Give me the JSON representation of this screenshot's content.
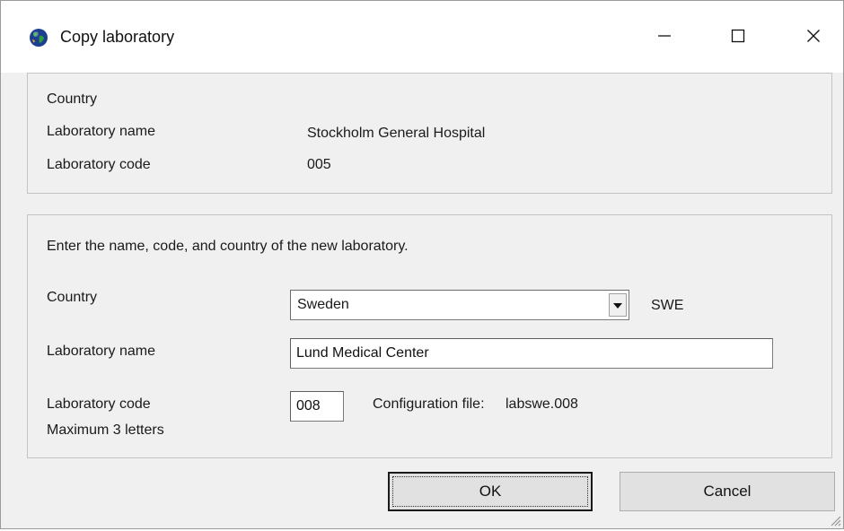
{
  "window": {
    "title": "Copy laboratory",
    "icon": "globe-icon",
    "controls": [
      "minimize-icon",
      "maximize-icon",
      "close-icon"
    ]
  },
  "current_lab": {
    "country_label": "Country",
    "name_label": "Laboratory name",
    "name_value": "Stockholm General Hospital",
    "code_label": "Laboratory code",
    "code_value": "005"
  },
  "new_lab": {
    "instruction": "Enter the name, code, and country of the new laboratory.",
    "country_label": "Country",
    "country_value": "Sweden",
    "country_code": "SWE",
    "name_label": "Laboratory name",
    "name_value": "Lund Medical Center",
    "code_label": "Laboratory code",
    "code_hint": "Maximum 3 letters",
    "code_value": "008",
    "config_label": "Configuration file:",
    "config_file": "labswe.008"
  },
  "buttons": {
    "ok": "OK",
    "cancel": "Cancel"
  }
}
